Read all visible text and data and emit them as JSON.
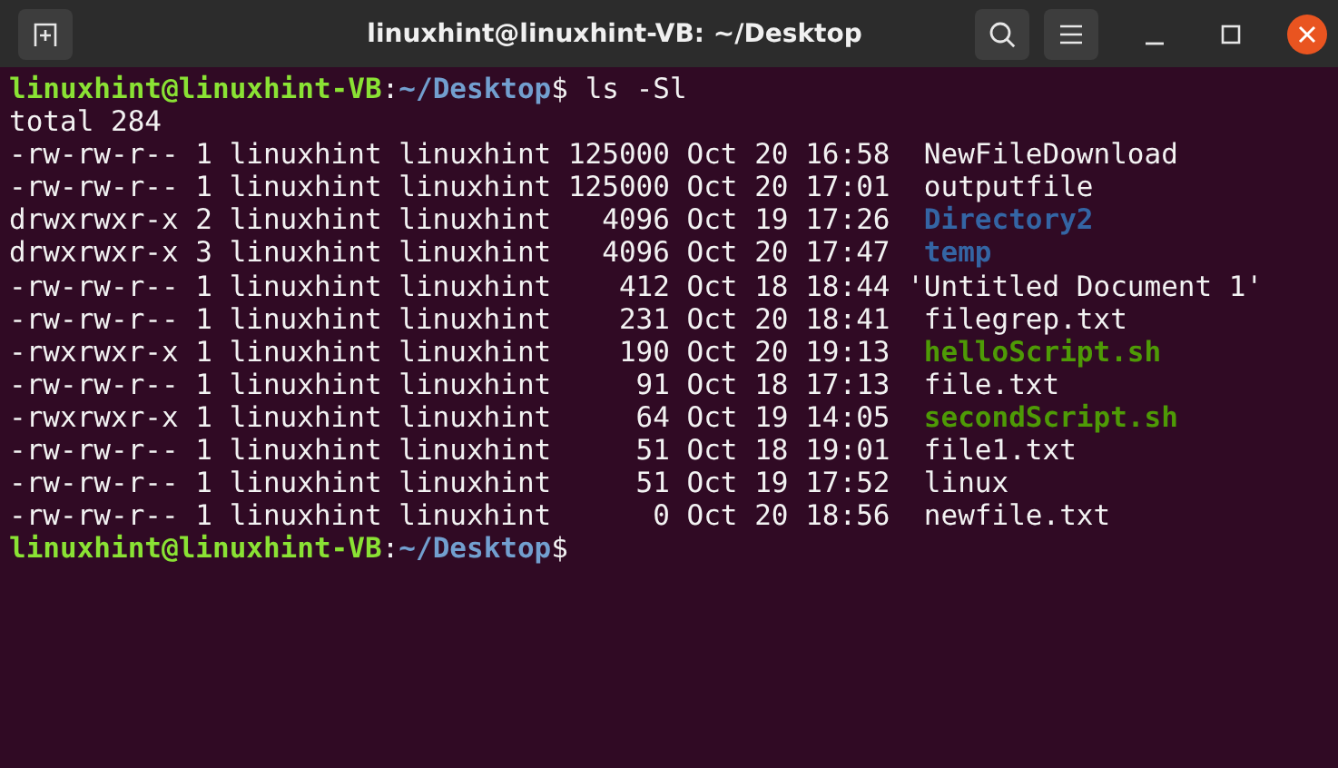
{
  "window": {
    "title": "linuxhint@linuxhint-VB: ~/Desktop"
  },
  "terminal": {
    "lines": [
      {
        "kind": "prompt",
        "user": "linuxhint@linuxhint-VB",
        "separator": ":",
        "path": "~/Desktop",
        "symbol": "$",
        "command": "ls -Sl"
      },
      {
        "kind": "text",
        "text": "total 284"
      },
      {
        "kind": "file",
        "details": "-rw-rw-r-- 1 linuxhint linuxhint 125000 Oct 20 16:58",
        "name": "NewFileDownload"
      },
      {
        "kind": "file",
        "details": "-rw-rw-r-- 1 linuxhint linuxhint 125000 Oct 20 17:01",
        "name": "outputfile"
      },
      {
        "kind": "dir",
        "details": "drwxrwxr-x 2 linuxhint linuxhint   4096 Oct 19 17:26",
        "name": "Directory2"
      },
      {
        "kind": "dir",
        "details": "drwxrwxr-x 3 linuxhint linuxhint   4096 Oct 20 17:47",
        "name": "temp"
      },
      {
        "kind": "quoted",
        "details": "-rw-rw-r-- 1 linuxhint linuxhint    412 Oct 18 18:44",
        "name": "'Untitled Document 1'"
      },
      {
        "kind": "file",
        "details": "-rw-rw-r-- 1 linuxhint linuxhint    231 Oct 20 18:41",
        "name": "filegrep.txt"
      },
      {
        "kind": "exec",
        "details": "-rwxrwxr-x 1 linuxhint linuxhint    190 Oct 20 19:13",
        "name": "helloScript.sh"
      },
      {
        "kind": "file",
        "details": "-rw-rw-r-- 1 linuxhint linuxhint     91 Oct 18 17:13",
        "name": "file.txt"
      },
      {
        "kind": "exec",
        "details": "-rwxrwxr-x 1 linuxhint linuxhint     64 Oct 19 14:05",
        "name": "secondScript.sh"
      },
      {
        "kind": "file",
        "details": "-rw-rw-r-- 1 linuxhint linuxhint     51 Oct 18 19:01",
        "name": "file1.txt"
      },
      {
        "kind": "file",
        "details": "-rw-rw-r-- 1 linuxhint linuxhint     51 Oct 19 17:52",
        "name": "linux"
      },
      {
        "kind": "file",
        "details": "-rw-rw-r-- 1 linuxhint linuxhint      0 Oct 20 18:56",
        "name": "newfile.txt"
      },
      {
        "kind": "prompt",
        "user": "linuxhint@linuxhint-VB",
        "separator": ":",
        "path": "~/Desktop",
        "symbol": "$"
      }
    ]
  }
}
